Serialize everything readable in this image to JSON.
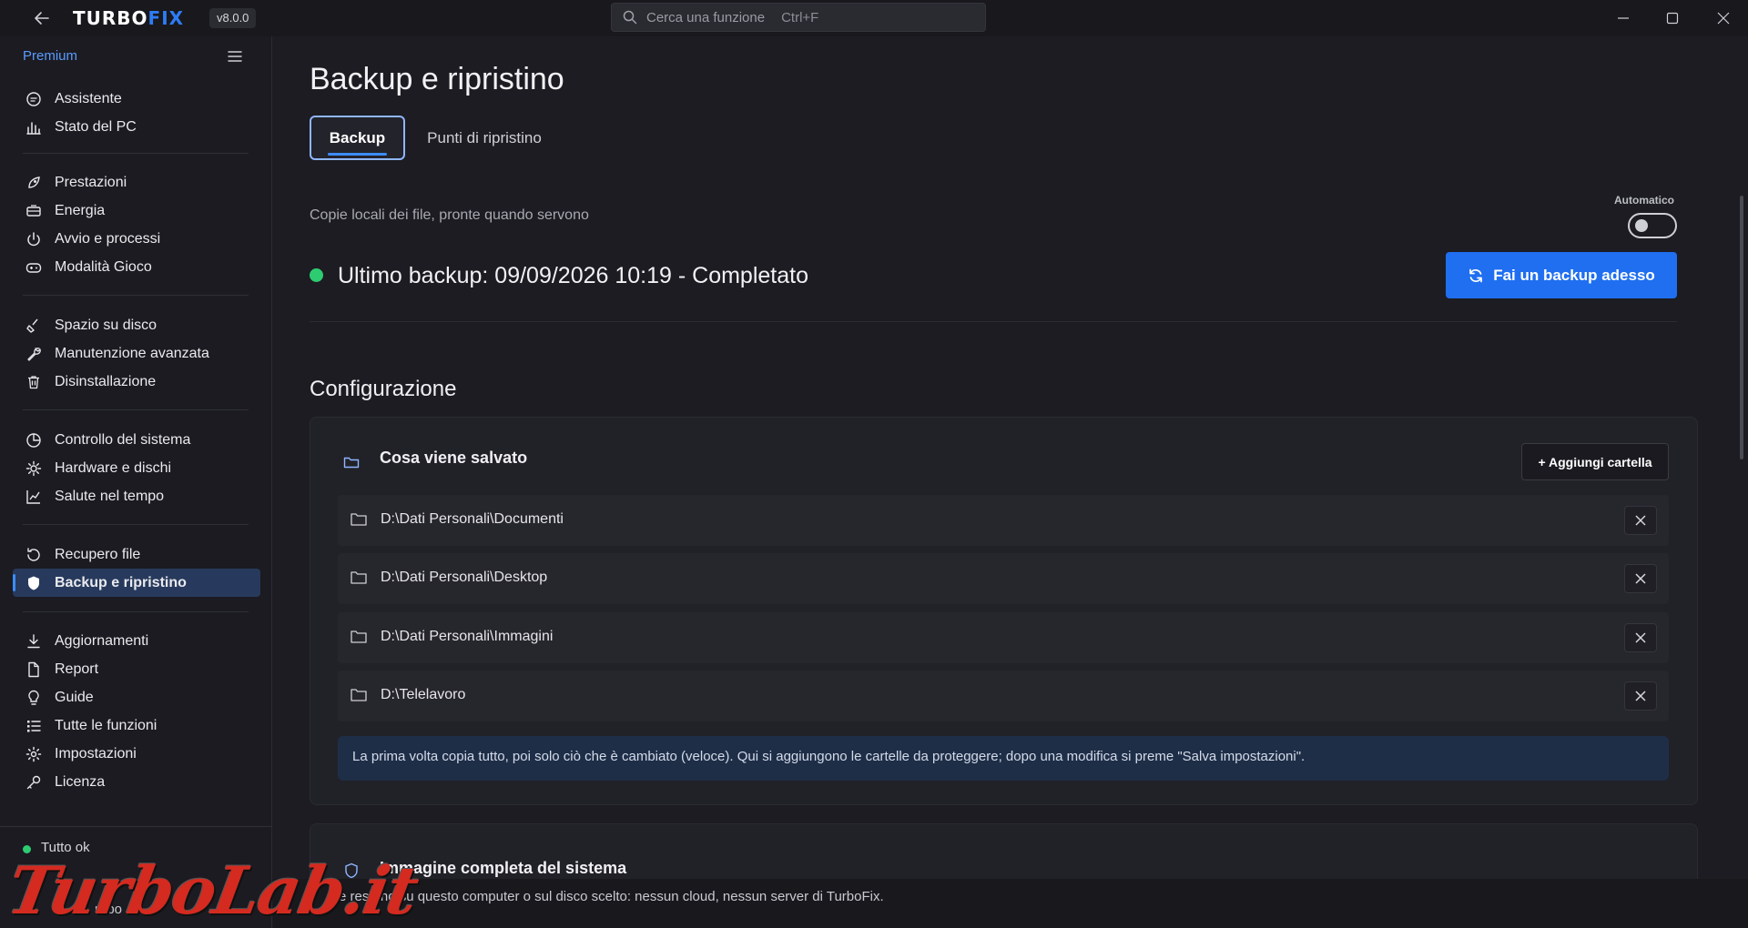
{
  "app": {
    "name_prefix": "TURBO",
    "name_suffix": "FIX",
    "version": "v8.0.0",
    "brand_color": "#2e7cf6"
  },
  "search": {
    "placeholder": "Cerca una funzione",
    "shortcut": "Ctrl+F"
  },
  "sidebar": {
    "tier": "Premium",
    "groups": [
      {
        "items": [
          {
            "label": "Assistente",
            "icon": "chat-icon"
          },
          {
            "label": "Stato del PC",
            "icon": "chart-bars-icon"
          }
        ]
      },
      {
        "items": [
          {
            "label": "Prestazioni",
            "icon": "rocket-icon"
          },
          {
            "label": "Energia",
            "icon": "battery-icon"
          },
          {
            "label": "Avvio e processi",
            "icon": "power-icon"
          },
          {
            "label": "Modalità Gioco",
            "icon": "gamepad-icon"
          }
        ]
      },
      {
        "items": [
          {
            "label": "Spazio su disco",
            "icon": "broom-icon"
          },
          {
            "label": "Manutenzione avanzata",
            "icon": "wrench-icon"
          },
          {
            "label": "Disinstallazione",
            "icon": "trash-icon"
          }
        ]
      },
      {
        "items": [
          {
            "label": "Controllo del sistema",
            "icon": "pie-icon"
          },
          {
            "label": "Hardware e dischi",
            "icon": "chip-icon"
          },
          {
            "label": "Salute nel tempo",
            "icon": "trend-icon"
          }
        ]
      },
      {
        "items": [
          {
            "label": "Recupero file",
            "icon": "restore-icon"
          },
          {
            "label": "Backup e ripristino",
            "icon": "shield-icon",
            "active": true
          }
        ]
      },
      {
        "items": [
          {
            "label": "Aggiornamenti",
            "icon": "download-icon"
          },
          {
            "label": "Report",
            "icon": "document-icon"
          },
          {
            "label": "Guide",
            "icon": "lightbulb-icon"
          },
          {
            "label": "Tutte le funzioni",
            "icon": "list-icon"
          },
          {
            "label": "Impostazioni",
            "icon": "gear-icon"
          },
          {
            "label": "Licenza",
            "icon": "key-icon"
          }
        ]
      }
    ],
    "status": {
      "text": "Tutto ok",
      "line2": "urbo",
      "color": "#2ecc71"
    }
  },
  "main": {
    "title": "Backup e ripristino",
    "tabs": [
      {
        "label": "Backup",
        "active": true
      },
      {
        "label": "Punti di ripristino",
        "active": false
      }
    ],
    "subtitle": "Copie locali dei file, pronte quando servono",
    "auto_label": "Automatico",
    "auto_enabled": false,
    "last_backup": "Ultimo backup: 09/09/2026 10:19 - Completato",
    "backup_now_label": "Fai un backup adesso",
    "config_title": "Configurazione",
    "what_saved": {
      "title": "Cosa viene salvato",
      "add_label": "+ Aggiungi cartella",
      "folders": [
        "D:\\Dati Personali\\Documenti",
        "D:\\Dati Personali\\Desktop",
        "D:\\Dati Personali\\Immagini",
        "D:\\Telelavoro"
      ],
      "info": "La prima volta copia tutto, poi solo ciò che è cambiato (veloce). Qui si aggiungono le cartelle da proteggere; dopo una modifica si preme \"Salva impostazioni\"."
    },
    "system_image": {
      "title": "Immagine completa del sistema"
    },
    "footer": "e restano su questo computer o sul disco scelto: nessun cloud, nessun server di TurboFix."
  },
  "watermark": {
    "text": "TurboLab.it"
  },
  "colors": {
    "accent": "#1f6ff0",
    "success": "#2ecc71",
    "background": "#1c1c22"
  }
}
